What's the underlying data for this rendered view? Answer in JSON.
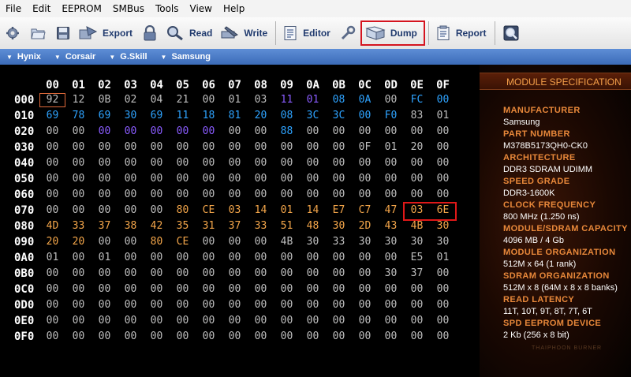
{
  "menu": [
    "File",
    "Edit",
    "EEPROM",
    "SMBus",
    "Tools",
    "View",
    "Help"
  ],
  "toolbar": {
    "export_label": "Export",
    "read_label": "Read",
    "write_label": "Write",
    "editor_label": "Editor",
    "dump_label": "Dump",
    "report_label": "Report"
  },
  "manufacturers": [
    "Hynix",
    "Corsair",
    "G.Skill",
    "Samsung"
  ],
  "hex": {
    "columns": [
      "00",
      "01",
      "02",
      "03",
      "04",
      "05",
      "06",
      "07",
      "08",
      "09",
      "0A",
      "0B",
      "0C",
      "0D",
      "0E",
      "0F"
    ],
    "rows": [
      {
        "addr": "000",
        "cells": [
          "92",
          "12",
          "0B",
          "02",
          "04",
          "21",
          "00",
          "01",
          "03",
          "11",
          "01",
          "08",
          "0A",
          "00",
          "FC",
          "00"
        ],
        "colors": "wwwwwwwwwppbbwbb"
      },
      {
        "addr": "010",
        "cells": [
          "69",
          "78",
          "69",
          "30",
          "69",
          "11",
          "18",
          "81",
          "20",
          "08",
          "3C",
          "3C",
          "00",
          "F0",
          "83",
          "01"
        ],
        "colors": "bbbbbbbbbbbbbbww"
      },
      {
        "addr": "020",
        "cells": [
          "00",
          "00",
          "00",
          "00",
          "00",
          "00",
          "00",
          "00",
          "00",
          "88",
          "00",
          "00",
          "00",
          "00",
          "00",
          "00"
        ],
        "colors": "wwpppppwwbwwwwww"
      },
      {
        "addr": "030",
        "cells": [
          "00",
          "00",
          "00",
          "00",
          "00",
          "00",
          "00",
          "00",
          "00",
          "00",
          "00",
          "00",
          "0F",
          "01",
          "20",
          "00"
        ],
        "colors": "wwwwwwwwwwwwwwww"
      },
      {
        "addr": "040",
        "cells": [
          "00",
          "00",
          "00",
          "00",
          "00",
          "00",
          "00",
          "00",
          "00",
          "00",
          "00",
          "00",
          "00",
          "00",
          "00",
          "00"
        ],
        "colors": "wwwwwwwwwwwwwwww"
      },
      {
        "addr": "050",
        "cells": [
          "00",
          "00",
          "00",
          "00",
          "00",
          "00",
          "00",
          "00",
          "00",
          "00",
          "00",
          "00",
          "00",
          "00",
          "00",
          "00"
        ],
        "colors": "wwwwwwwwwwwwwwww"
      },
      {
        "addr": "060",
        "cells": [
          "00",
          "00",
          "00",
          "00",
          "00",
          "00",
          "00",
          "00",
          "00",
          "00",
          "00",
          "00",
          "00",
          "00",
          "00",
          "00"
        ],
        "colors": "wwwwwwwwwwwwwwww"
      },
      {
        "addr": "070",
        "cells": [
          "00",
          "00",
          "00",
          "00",
          "00",
          "80",
          "CE",
          "03",
          "14",
          "01",
          "14",
          "E7",
          "C7",
          "47",
          "03",
          "6E"
        ],
        "colors": "wwwwwooooooooooo"
      },
      {
        "addr": "080",
        "cells": [
          "4D",
          "33",
          "37",
          "38",
          "42",
          "35",
          "31",
          "37",
          "33",
          "51",
          "48",
          "30",
          "2D",
          "43",
          "4B",
          "30"
        ],
        "colors": "oooooooooooooooo"
      },
      {
        "addr": "090",
        "cells": [
          "20",
          "20",
          "00",
          "00",
          "80",
          "CE",
          "00",
          "00",
          "00",
          "4B",
          "30",
          "33",
          "30",
          "30",
          "30",
          "30"
        ],
        "colors": "oowwoowwwwwwwwww"
      },
      {
        "addr": "0A0",
        "cells": [
          "01",
          "00",
          "01",
          "00",
          "00",
          "00",
          "00",
          "00",
          "00",
          "00",
          "00",
          "00",
          "00",
          "00",
          "E5",
          "01"
        ],
        "colors": "wwwwwwwwwwwwwwww"
      },
      {
        "addr": "0B0",
        "cells": [
          "00",
          "00",
          "00",
          "00",
          "00",
          "00",
          "00",
          "00",
          "00",
          "00",
          "00",
          "00",
          "00",
          "30",
          "37",
          "00"
        ],
        "colors": "wwwwwwwwwwwwwwww"
      },
      {
        "addr": "0C0",
        "cells": [
          "00",
          "00",
          "00",
          "00",
          "00",
          "00",
          "00",
          "00",
          "00",
          "00",
          "00",
          "00",
          "00",
          "00",
          "00",
          "00"
        ],
        "colors": "wwwwwwwwwwwwwwww"
      },
      {
        "addr": "0D0",
        "cells": [
          "00",
          "00",
          "00",
          "00",
          "00",
          "00",
          "00",
          "00",
          "00",
          "00",
          "00",
          "00",
          "00",
          "00",
          "00",
          "00"
        ],
        "colors": "wwwwwwwwwwwwwwww"
      },
      {
        "addr": "0E0",
        "cells": [
          "00",
          "00",
          "00",
          "00",
          "00",
          "00",
          "00",
          "00",
          "00",
          "00",
          "00",
          "00",
          "00",
          "00",
          "00",
          "00"
        ],
        "colors": "wwwwwwwwwwwwwwww"
      },
      {
        "addr": "0F0",
        "cells": [
          "00",
          "00",
          "00",
          "00",
          "00",
          "00",
          "00",
          "00",
          "00",
          "00",
          "00",
          "00",
          "00",
          "00",
          "00",
          "00"
        ],
        "colors": "wwwwwwwwwwwwwwww"
      }
    ]
  },
  "spec": {
    "title": "MODULE SPECIFICATION",
    "items": [
      {
        "label": "MANUFACTURER",
        "value": "Samsung"
      },
      {
        "label": "PART NUMBER",
        "value": "M378B5173QH0-CK0"
      },
      {
        "label": "ARCHITECTURE",
        "value": "DDR3 SDRAM UDIMM"
      },
      {
        "label": "SPEED GRADE",
        "value": "DDR3-1600K"
      },
      {
        "label": "CLOCK FREQUENCY",
        "value": "800 MHz (1.250 ns)"
      },
      {
        "label": "MODULE/SDRAM CAPACITY",
        "value": "4096 MB / 4 Gb"
      },
      {
        "label": "MODULE ORGANIZATION",
        "value": "512M x 64 (1 rank)"
      },
      {
        "label": "SDRAM ORGANIZATION",
        "value": "512M x 8 (64M x 8 x 8 banks)"
      },
      {
        "label": "READ LATENCY",
        "value": "11T, 10T, 9T, 8T, 7T, 6T"
      },
      {
        "label": "SPD EEPROM DEVICE",
        "value": "2 Kb (256 x 8 bit)"
      }
    ],
    "footer": "THAIPHOON BURNER"
  },
  "colors": {
    "accent": "#d5141f",
    "hex_default": "#bfbfbf",
    "hex_blue": "#2ea3ff",
    "hex_purple": "#8a5cff",
    "hex_orange": "#f4a64a",
    "spec_label": "#e8883a"
  }
}
